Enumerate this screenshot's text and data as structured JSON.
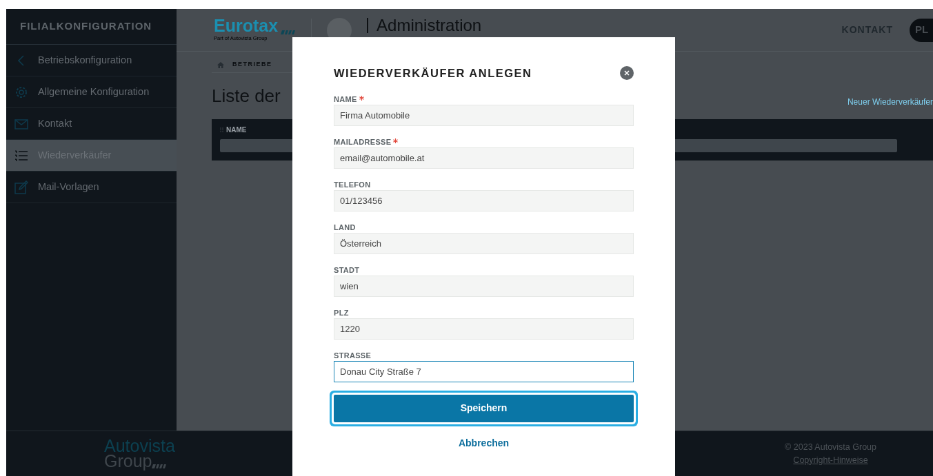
{
  "sidebar": {
    "title": "FILIALKONFIGURATION",
    "items": [
      {
        "label": "Betriebskonfiguration",
        "selected": false
      },
      {
        "label": "Allgemeine Konfiguration",
        "selected": false
      },
      {
        "label": "Kontakt",
        "selected": false
      },
      {
        "label": "Wiederverkäufer",
        "selected": true
      },
      {
        "label": "Mail-Vorlagen",
        "selected": false
      }
    ]
  },
  "header": {
    "logo_text": "Eurotax",
    "logo_subtitle": "Part of Autovista Group",
    "app_title": "Administration",
    "contact_link": "KONTAKT",
    "avatar": "PL"
  },
  "breadcrumb": [
    {
      "label": "BETRIEBE"
    }
  ],
  "page": {
    "title": "Liste der",
    "new_link": "Neuer Wiederverkäufer"
  },
  "table": {
    "columns": [
      {
        "label": "NAME"
      }
    ]
  },
  "modal": {
    "title": "WIEDERVERKÄUFER ANLEGEN",
    "fields": [
      {
        "label": "NAME",
        "required": true,
        "value": "Firma Automobile",
        "focused": false
      },
      {
        "label": "MAILADRESSE",
        "required": true,
        "value": "email@automobile.at",
        "focused": false
      },
      {
        "label": "TELEFON",
        "required": false,
        "value": "01/123456",
        "focused": false
      },
      {
        "label": "LAND",
        "required": false,
        "value": "Österreich",
        "focused": false
      },
      {
        "label": "STADT",
        "required": false,
        "value": "wien",
        "focused": false
      },
      {
        "label": "PLZ",
        "required": false,
        "value": "1220",
        "focused": false
      },
      {
        "label": "STRASSE",
        "required": false,
        "value": "Donau City Straße 7",
        "focused": true
      }
    ],
    "save_button": {
      "label": "Speichern",
      "focused": true
    },
    "cancel_link": "Abbrechen"
  },
  "footer": {
    "logo_top": "Autovista",
    "logo_bottom": "Group",
    "copyright": "© 2023 Autovista Group",
    "link": "Copyright-Hinweise"
  }
}
